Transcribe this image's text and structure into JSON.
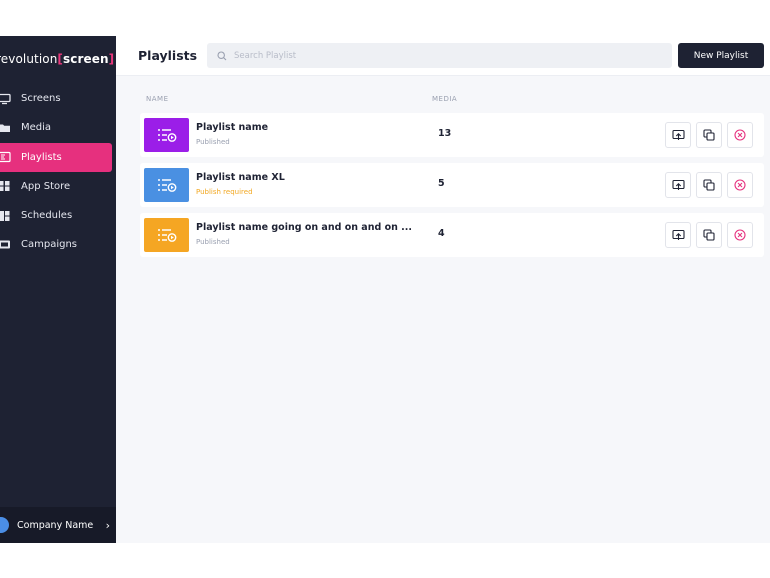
{
  "brand": {
    "pre": "revolution",
    "name": "screen",
    "accent": "#e6307e"
  },
  "sidebar": {
    "items": [
      {
        "label": "Screens",
        "icon": "monitor-icon",
        "active": false
      },
      {
        "label": "Media",
        "icon": "folder-icon",
        "active": false
      },
      {
        "label": "Playlists",
        "icon": "playlist-icon",
        "active": true
      },
      {
        "label": "App Store",
        "icon": "app-grid-icon",
        "active": false
      },
      {
        "label": "Schedules",
        "icon": "schedule-icon",
        "active": false
      },
      {
        "label": "Campaigns",
        "icon": "campaign-icon",
        "active": false
      }
    ],
    "user": {
      "name": "Company Name"
    }
  },
  "header": {
    "title": "Playlists",
    "search_placeholder": "Search Playlist",
    "new_button": "New Playlist"
  },
  "table": {
    "columns": {
      "name": "NAME",
      "media": "MEDIA"
    },
    "rows": [
      {
        "name": "Playlist name",
        "status": "Published",
        "media": "13",
        "color": "#9b1ee8"
      },
      {
        "name": "Playlist name XL",
        "status": "Publish required",
        "media": "5",
        "color": "#4a90e2"
      },
      {
        "name": "Playlist name going on and on and on ...",
        "status": "Published",
        "media": "4",
        "color": "#f5a623"
      }
    ]
  },
  "colors": {
    "sidebar_bg": "#1e2233",
    "warn": "#f2a823",
    "delete": "#e6307e"
  }
}
